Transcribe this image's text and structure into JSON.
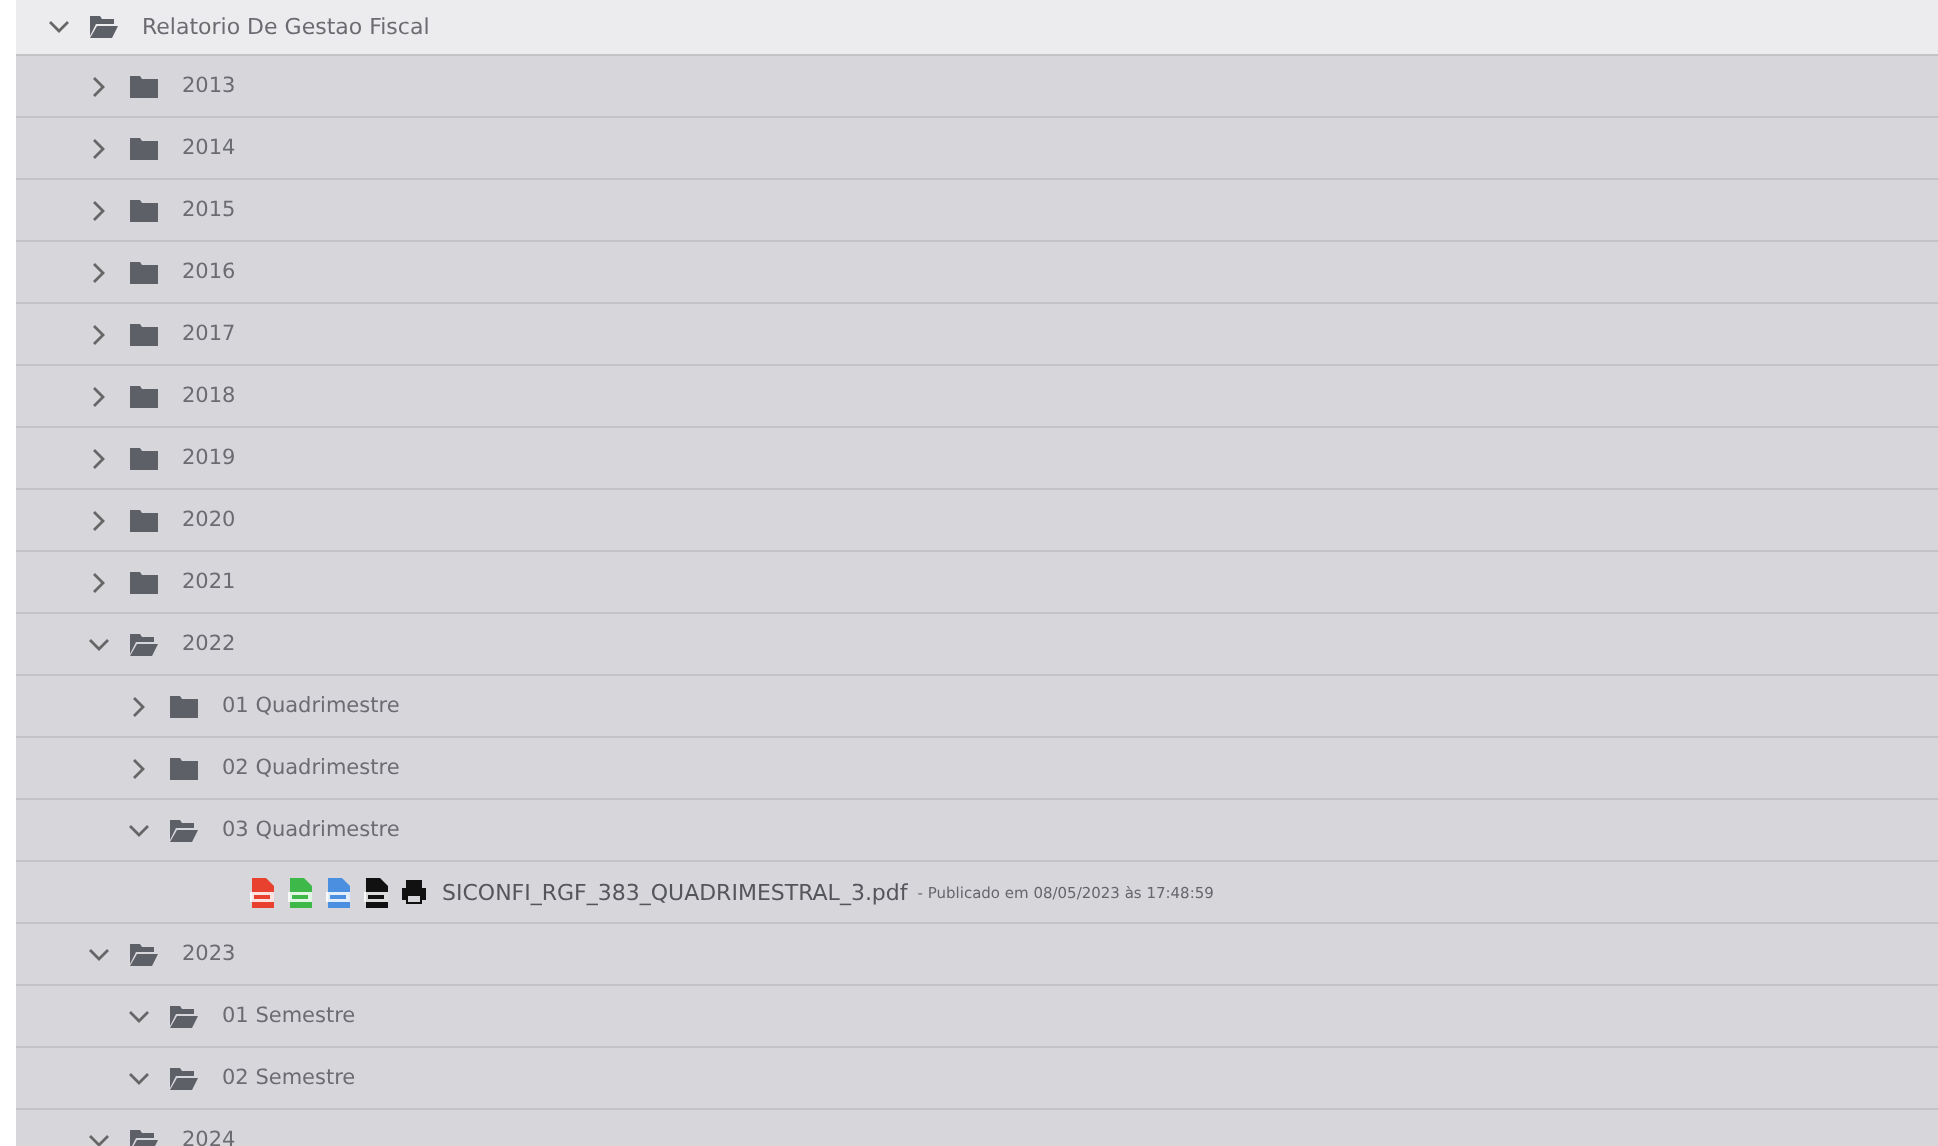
{
  "tree": {
    "label": "Relatorio De Gestao Fiscal",
    "expanded": true,
    "children": [
      {
        "label": "2013",
        "expanded": false
      },
      {
        "label": "2014",
        "expanded": false
      },
      {
        "label": "2015",
        "expanded": false
      },
      {
        "label": "2016",
        "expanded": false
      },
      {
        "label": "2017",
        "expanded": false
      },
      {
        "label": "2018",
        "expanded": false
      },
      {
        "label": "2019",
        "expanded": false
      },
      {
        "label": "2020",
        "expanded": false
      },
      {
        "label": "2021",
        "expanded": false
      },
      {
        "label": "2022",
        "expanded": true,
        "children": [
          {
            "label": "01 Quadrimestre",
            "expanded": false
          },
          {
            "label": "02 Quadrimestre",
            "expanded": false
          },
          {
            "label": "03 Quadrimestre",
            "expanded": true,
            "children": [
              {
                "kind": "file",
                "name": "SICONFI_RGF_383_QUADRIMESTRAL_3.pdf",
                "note": "- Publicado em 08/05/2023 às 17:48:59",
                "formats": [
                  {
                    "kind": "pdf",
                    "color": "#e8412f"
                  },
                  {
                    "kind": "sheet",
                    "color": "#3fb84a"
                  },
                  {
                    "kind": "doc",
                    "color": "#4a8fe0"
                  },
                  {
                    "kind": "xml",
                    "color": "#111111"
                  },
                  {
                    "kind": "print",
                    "color": "#111111"
                  }
                ]
              }
            ]
          }
        ]
      },
      {
        "label": "2023",
        "expanded": true,
        "children": [
          {
            "label": "01 Semestre",
            "expanded": true
          },
          {
            "label": "02 Semestre",
            "expanded": true
          }
        ]
      },
      {
        "label": "2024",
        "expanded": true
      }
    ]
  }
}
